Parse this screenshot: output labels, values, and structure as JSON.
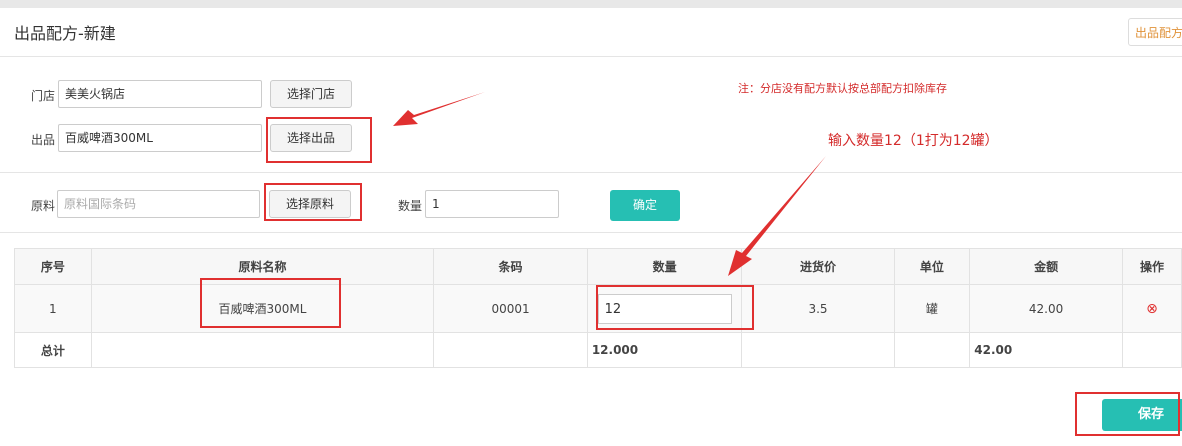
{
  "header": {
    "title": "出品配方-新建",
    "top_right_button": "出品配方"
  },
  "form": {
    "store_label": "门店",
    "store_value": "美美火锅店",
    "select_store_button": "选择门店",
    "product_label": "出品",
    "product_value": "百威啤酒300ML",
    "select_product_button": "选择出品",
    "note": "注：分店没有配方默认按总部配方扣除库存",
    "material_label": "原料",
    "material_placeholder": "原料国际条码",
    "select_material_button": "选择原料",
    "quantity_label": "数量",
    "quantity_value": "1",
    "confirm_button": "确定"
  },
  "annotation": {
    "text": "输入数量12（1打为12罐）"
  },
  "table": {
    "headers": [
      "序号",
      "原料名称",
      "条码",
      "数量",
      "进货价",
      "单位",
      "金额",
      "操作"
    ],
    "rows": [
      {
        "index": "1",
        "name": "百威啤酒300ML",
        "barcode": "00001",
        "quantity": "12",
        "price": "3.5",
        "unit": "罐",
        "amount": "42.00",
        "action_icon": "remove-icon"
      }
    ],
    "total": {
      "label": "总计",
      "quantity": "12.000",
      "amount": "42.00"
    }
  },
  "footer": {
    "save_button": "保存"
  },
  "colors": {
    "accent": "#26bfb3",
    "annotation_red": "#e03030"
  }
}
